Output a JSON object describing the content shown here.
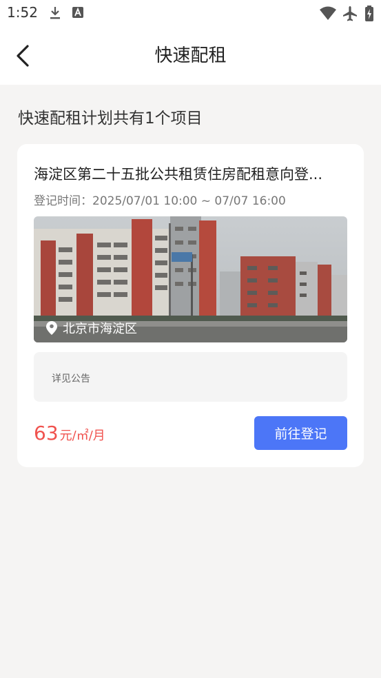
{
  "status_bar": {
    "time": "1:52"
  },
  "header": {
    "title": "快速配租"
  },
  "summary": "快速配租计划共有1个项目",
  "project": {
    "title": "海淀区第二十五批公共租赁住房配租意向登...",
    "registration_time": "登记时间：2025/07/01 10:00 ~ 07/07 16:00",
    "location": "北京市海淀区",
    "notice": "详见公告",
    "price_value": "63",
    "price_unit": "元/㎡/月",
    "action_label": "前往登记"
  },
  "colors": {
    "accent": "#4c76f7",
    "price": "#f0524e",
    "background": "#f5f4f3"
  }
}
